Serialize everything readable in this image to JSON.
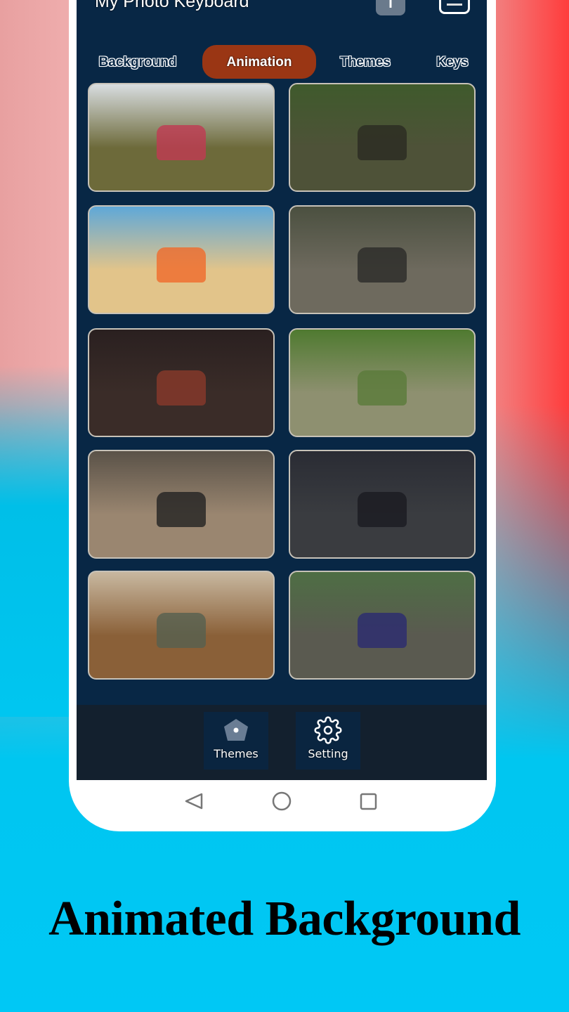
{
  "app": {
    "title": "My Photo Keyboard",
    "font_icon_label": "T"
  },
  "tabs": [
    {
      "label": "Background",
      "active": false
    },
    {
      "label": "Animation",
      "active": true
    },
    {
      "label": "Themes",
      "active": false
    },
    {
      "label": "Keys",
      "active": false
    }
  ],
  "colors": {
    "screen_bg": "#082745",
    "active_tab": "#9a3614",
    "bottom_nav": "#13202e"
  },
  "thumbnails": [
    {
      "sky": "#d8dde0",
      "ground": "#6d6a3a",
      "accent": "#c03a52"
    },
    {
      "sky": "#3f5a2c",
      "ground": "#4e5238",
      "accent": "#2a2a22"
    },
    {
      "sky": "#5fa8d8",
      "ground": "#e2c48a",
      "accent": "#f06a2a"
    },
    {
      "sky": "#4b5040",
      "ground": "#6e6a5e",
      "accent": "#2a2a28"
    },
    {
      "sky": "#2a2020",
      "ground": "#3a2c28",
      "accent": "#8a3a2a"
    },
    {
      "sky": "#4f7a30",
      "ground": "#8e9070",
      "accent": "#5a7a3a"
    },
    {
      "sky": "#5a5248",
      "ground": "#9a8670",
      "accent": "#222"
    },
    {
      "sky": "#2a2c34",
      "ground": "#3a3c40",
      "accent": "#1a1a20"
    },
    {
      "sky": "#c8b8a0",
      "ground": "#8a6038",
      "accent": "#556050"
    },
    {
      "sky": "#4e6e44",
      "ground": "#5a5a50",
      "accent": "#2a2a70"
    }
  ],
  "bottom_nav": [
    {
      "label": "Themes",
      "icon": "pentagon-icon"
    },
    {
      "label": "Setting",
      "icon": "gear-icon"
    }
  ],
  "system_nav": [
    "back-icon",
    "home-icon",
    "recents-icon"
  ],
  "promo_title": "Animated Background"
}
